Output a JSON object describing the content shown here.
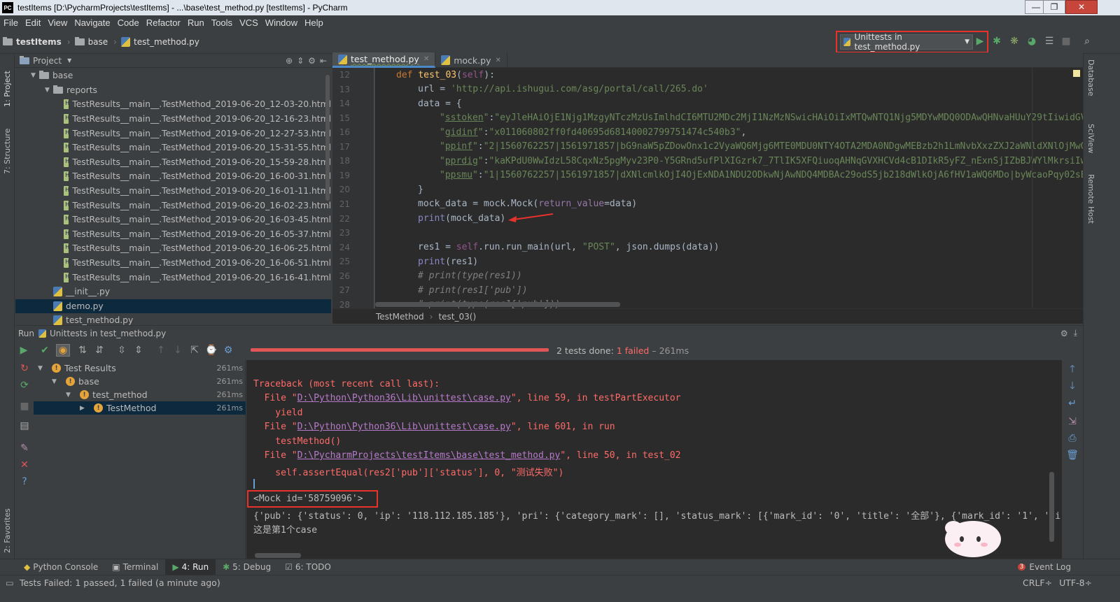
{
  "window": {
    "title": "testItems [D:\\PycharmProjects\\testItems] - ...\\base\\test_method.py [testItems] - PyCharm",
    "logo": "PC",
    "minimize": "—",
    "maximize": "❐",
    "close": "✕"
  },
  "menu": [
    "File",
    "Edit",
    "View",
    "Navigate",
    "Code",
    "Refactor",
    "Run",
    "Tools",
    "VCS",
    "Window",
    "Help"
  ],
  "navbar": {
    "crumbs": [
      "testItems",
      "base",
      "test_method.py"
    ],
    "run_config": "Unittests in test_method.py"
  },
  "left_stripe": {
    "project": "1: Project",
    "structure": "7: Structure",
    "favorites": "2: Favorites"
  },
  "right_stripe": {
    "database": "Database",
    "sciview": "SciView",
    "remote_host": "Remote Host"
  },
  "project": {
    "header": "Project",
    "tree": [
      {
        "label": "base",
        "type": "folder",
        "indent": 0,
        "arrow": "▼"
      },
      {
        "label": "reports",
        "type": "folder",
        "indent": 1,
        "arrow": "▼"
      },
      {
        "label": "TestResults__main__.TestMethod_2019-06-20_12-03-20.html",
        "type": "html",
        "indent": 2
      },
      {
        "label": "TestResults__main__.TestMethod_2019-06-20_12-16-23.html",
        "type": "html",
        "indent": 2
      },
      {
        "label": "TestResults__main__.TestMethod_2019-06-20_12-27-53.html",
        "type": "html",
        "indent": 2
      },
      {
        "label": "TestResults__main__.TestMethod_2019-06-20_15-31-55.html",
        "type": "html",
        "indent": 2
      },
      {
        "label": "TestResults__main__.TestMethod_2019-06-20_15-59-28.html",
        "type": "html",
        "indent": 2
      },
      {
        "label": "TestResults__main__.TestMethod_2019-06-20_16-00-31.html",
        "type": "html",
        "indent": 2
      },
      {
        "label": "TestResults__main__.TestMethod_2019-06-20_16-01-11.html",
        "type": "html",
        "indent": 2
      },
      {
        "label": "TestResults__main__.TestMethod_2019-06-20_16-02-23.html",
        "type": "html",
        "indent": 2
      },
      {
        "label": "TestResults__main__.TestMethod_2019-06-20_16-03-45.html",
        "type": "html",
        "indent": 2
      },
      {
        "label": "TestResults__main__.TestMethod_2019-06-20_16-05-37.html",
        "type": "html",
        "indent": 2
      },
      {
        "label": "TestResults__main__.TestMethod_2019-06-20_16-06-25.html",
        "type": "html",
        "indent": 2
      },
      {
        "label": "TestResults__main__.TestMethod_2019-06-20_16-06-51.html",
        "type": "html",
        "indent": 2
      },
      {
        "label": "TestResults__main__.TestMethod_2019-06-20_16-16-41.html",
        "type": "html",
        "indent": 2
      },
      {
        "label": "__init__.py",
        "type": "py",
        "indent": 1
      },
      {
        "label": "demo.py",
        "type": "py",
        "indent": 1,
        "selected": true
      },
      {
        "label": "test_method.py",
        "type": "py",
        "indent": 1
      }
    ]
  },
  "editor": {
    "tabs": [
      {
        "label": "test_method.py",
        "active": true
      },
      {
        "label": "mock.py",
        "active": false
      }
    ],
    "line_numbers": [
      "12",
      "13",
      "14",
      "15",
      "16",
      "17",
      "18",
      "19",
      "20",
      "21",
      "22",
      "23",
      "24",
      "25",
      "26",
      "27",
      "28"
    ],
    "breadcrumb": [
      "TestMethod",
      "test_03()"
    ]
  },
  "run": {
    "header_prefix": "Run",
    "header_config": "Unittests in test_method.py",
    "summary_prefix": "2 tests done: ",
    "summary_failed": "1 failed",
    "summary_time": " – 261ms",
    "progress_fraction": 0.55,
    "tree": [
      {
        "label": "Test Results",
        "time": "261ms",
        "indent": 0,
        "arrow": "▼"
      },
      {
        "label": "base",
        "time": "261ms",
        "indent": 1,
        "arrow": "▼"
      },
      {
        "label": "test_method",
        "time": "261ms",
        "indent": 2,
        "arrow": "▼"
      },
      {
        "label": "TestMethod",
        "time": "261ms",
        "indent": 3,
        "arrow": "▶",
        "selected": true
      }
    ],
    "console": {
      "traceback": "Traceback (most recent call last):",
      "file1_pre": "  File \"",
      "file1_path": "D:\\Python\\Python36\\Lib\\unittest\\case.py",
      "file1_post": "\", line 59, in testPartExecutor",
      "yield": "    yield",
      "file2_pre": "  File \"",
      "file2_path": "D:\\Python\\Python36\\Lib\\unittest\\case.py",
      "file2_post": "\", line 601, in run",
      "testmethod": "    testMethod()",
      "file3_pre": "  File \"",
      "file3_path": "D:\\PycharmProjects\\testItems\\base\\test_method.py",
      "file3_post": "\", line 50, in test_02",
      "assert": "    self.assertEqual(res2['pub']['status'], 0, \"测试失败\")",
      "mock": "<Mock id='58759096'>",
      "pub": "{'pub': {'status': 0, 'ip': '118.112.185.185'}, 'pri': {'category_mark': [], 'status_mark': [{'mark_id': '0', 'title': '全部'}, {'mark_id': '1', 'ti",
      "case": "这是第1个case"
    }
  },
  "bottom_tabs": [
    {
      "label": "Python Console",
      "active": false
    },
    {
      "label": "Terminal",
      "active": false
    },
    {
      "label": "4: Run",
      "active": true
    },
    {
      "label": "5: Debug",
      "active": false
    },
    {
      "label": "6: TODO",
      "active": false
    }
  ],
  "event_log": {
    "count": "3",
    "label": "Event Log"
  },
  "status": {
    "message": "Tests Failed: 1 passed, 1 failed (a minute ago)",
    "line_sep": "CRLF÷",
    "encoding": "UTF-8÷"
  },
  "colors": {
    "accent_red": "#e8322c",
    "run_green": "#59a869",
    "warn": "#e5a43a"
  }
}
